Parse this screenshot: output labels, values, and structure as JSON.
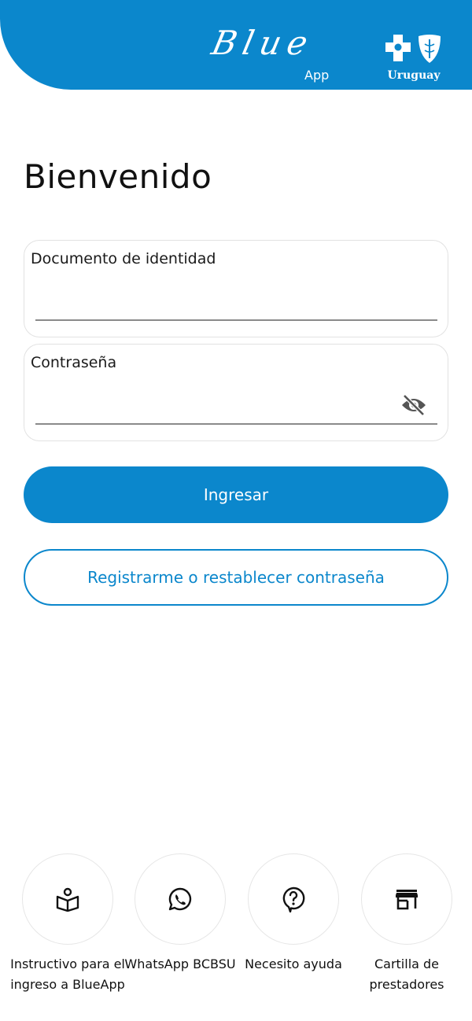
{
  "header": {
    "brand_script": "Blue",
    "brand_sub": "App",
    "partner_name": "Uruguay"
  },
  "title": "Bienvenido",
  "form": {
    "document": {
      "label": "Documento de identidad",
      "value": ""
    },
    "password": {
      "label": "Contraseña",
      "value": ""
    },
    "submit_label": "Ingresar",
    "register_label": "Registrarme o restablecer contraseña"
  },
  "shortcuts": [
    {
      "label": "Instructivo para el ingreso a BlueApp",
      "icon": "book-person-icon"
    },
    {
      "label": "WhatsApp BCBSU",
      "icon": "whatsapp-icon"
    },
    {
      "label": "Necesito ayuda",
      "icon": "help-bubble-icon"
    },
    {
      "label": "Cartilla de prestadores",
      "icon": "storefront-icon"
    }
  ],
  "colors": {
    "primary": "#0b87cc",
    "text": "#111111",
    "border": "#e2e2e2"
  }
}
